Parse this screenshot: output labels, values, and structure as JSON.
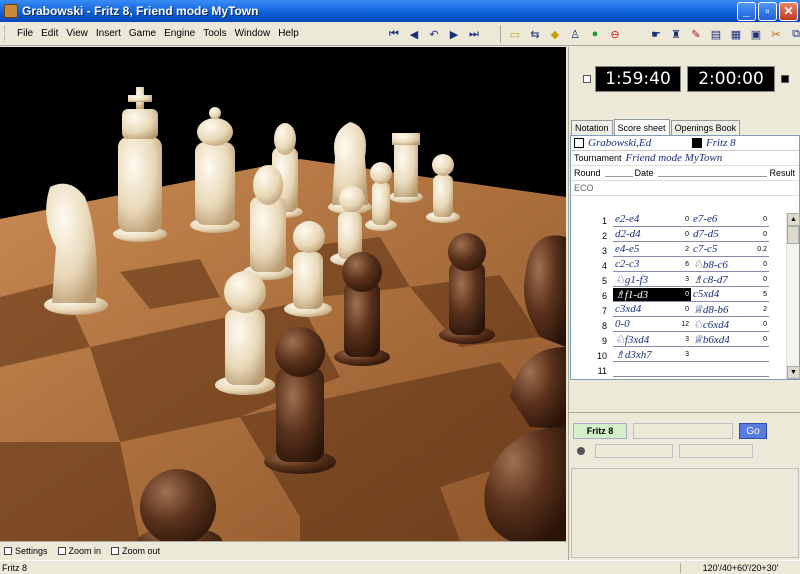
{
  "window": {
    "title": "Grabowski - Fritz 8, Friend mode MyTown"
  },
  "menu": [
    "File",
    "Edit",
    "View",
    "Insert",
    "Game",
    "Engine",
    "Tools",
    "Window",
    "Help"
  ],
  "bottom_bar": {
    "settings": "Settings",
    "zoom_in": "Zoom in",
    "zoom_out": "Zoom out"
  },
  "status": {
    "left": "Fritz 8",
    "right": "120'/40+60'/20+30'"
  },
  "clocks": {
    "white": "1:59:40",
    "black": "2:00:00"
  },
  "tabs": [
    "Notation",
    "Score sheet",
    "Openings Book"
  ],
  "notation": {
    "white_player": "Grabowski,Ed",
    "black_player": "Fritz 8",
    "tournament_label": "Tournament",
    "tournament": "Friend mode MyTown",
    "round_label": "Round",
    "date_label": "Date",
    "result_label": "Result",
    "eco_label": "ECO",
    "moves": [
      {
        "no": "1",
        "w": "e2-e4",
        "wt": "0",
        "b": "e7-e6",
        "bt": "0"
      },
      {
        "no": "2",
        "w": "d2-d4",
        "wt": "0",
        "b": "d7-d5",
        "bt": "0"
      },
      {
        "no": "3",
        "w": "e4-e5",
        "wt": "2",
        "b": "c7-c5",
        "bt": "0.2"
      },
      {
        "no": "4",
        "w": "c2-c3",
        "wt": "6",
        "b": "♘b8-c6",
        "bt": "0"
      },
      {
        "no": "5",
        "w": "♘g1-f3",
        "wt": "3",
        "b": "♗c8-d7",
        "bt": "0"
      },
      {
        "no": "6",
        "w": "♗f1-d3",
        "wt": "0",
        "b": "c5xd4",
        "bt": "5"
      },
      {
        "no": "7",
        "w": "c3xd4",
        "wt": "0",
        "b": "♕d8-b6",
        "bt": "2"
      },
      {
        "no": "8",
        "w": "0-0",
        "wt": "12",
        "b": "♘c6xd4",
        "bt": "0"
      },
      {
        "no": "9",
        "w": "♘f3xd4",
        "wt": "3",
        "b": "♕b6xd4",
        "bt": "0"
      },
      {
        "no": "10",
        "w": "♗d3xh7",
        "wt": "3",
        "b": "",
        "bt": ""
      },
      {
        "no": "11",
        "w": "",
        "wt": "",
        "b": "",
        "bt": ""
      }
    ],
    "selected_move_index": 5
  },
  "engine": {
    "name": "Fritz 8",
    "go": "Go"
  }
}
